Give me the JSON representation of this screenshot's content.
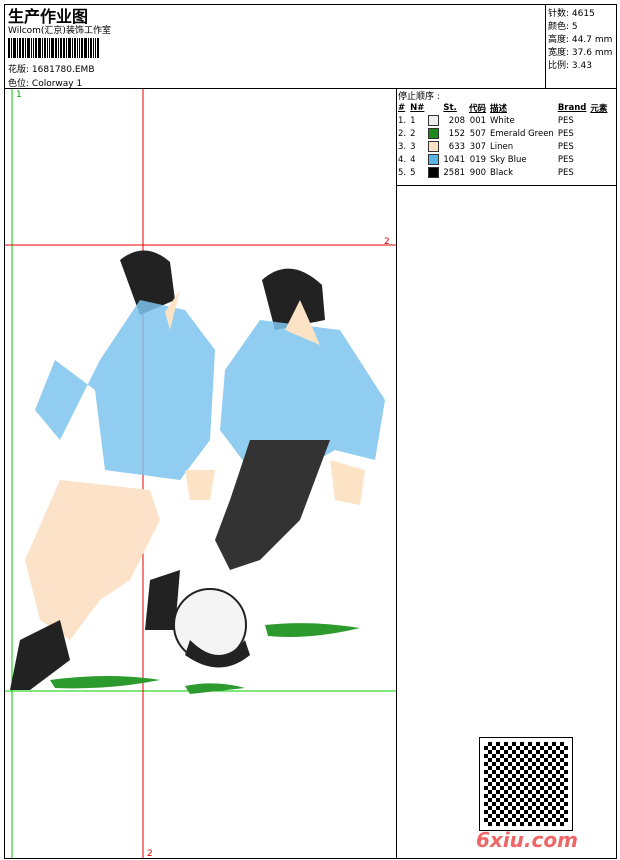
{
  "header": {
    "title": "生产作业图",
    "company": "Wilcom(汇京)装饰工作室",
    "design_label": "花版:",
    "design_value": "1681780.EMB",
    "colorway_label": "色位:",
    "colorway_value": "Colorway 1"
  },
  "info": [
    {
      "label": "针数:",
      "value": "4615"
    },
    {
      "label": "颜色:",
      "value": "5"
    },
    {
      "label": "高度:",
      "value": "44.7 mm"
    },
    {
      "label": "宽度:",
      "value": "37.6 mm"
    },
    {
      "label": "比例:",
      "value": "3.43"
    }
  ],
  "stop_sequence": {
    "title": "停止顺序 :",
    "headers": [
      "#",
      "N#",
      "St.",
      "代码",
      "描述",
      "Brand",
      "元素"
    ],
    "rows": [
      {
        "idx": "1.",
        "n": "1",
        "color": "#eeeeee",
        "st": "208",
        "code": "001",
        "desc": "White",
        "brand": "PES"
      },
      {
        "idx": "2.",
        "n": "2",
        "color": "#1e8a1e",
        "st": "152",
        "code": "507",
        "desc": "Emerald Green",
        "brand": "PES"
      },
      {
        "idx": "3.",
        "n": "3",
        "color": "#fde3c6",
        "st": "633",
        "code": "307",
        "desc": "Linen",
        "brand": "PES"
      },
      {
        "idx": "4.",
        "n": "4",
        "color": "#5ab4e8",
        "st": "1041",
        "code": "019",
        "desc": "Sky Blue",
        "brand": "PES"
      },
      {
        "idx": "5.",
        "n": "5",
        "color": "#000000",
        "st": "2581",
        "code": "900",
        "desc": "Black",
        "brand": "PES"
      }
    ]
  },
  "guides": {
    "green_label": "1",
    "red_h_label": "2",
    "red_v_label": "2"
  },
  "watermark": "6xiu.com"
}
